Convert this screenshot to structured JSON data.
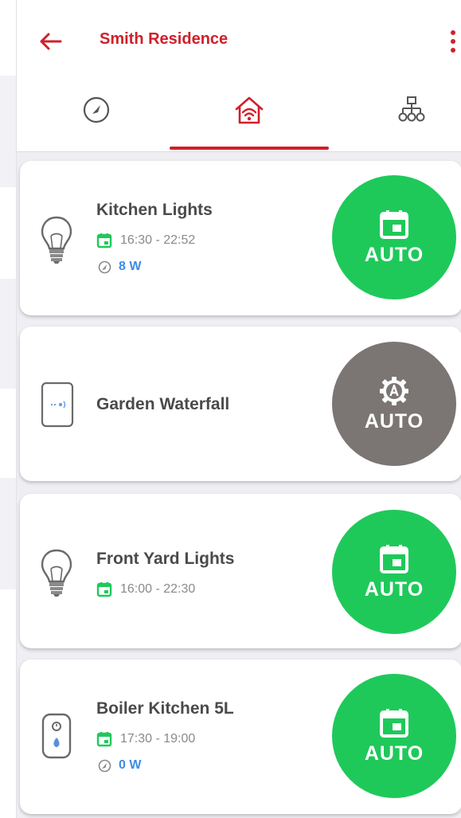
{
  "header": {
    "title": "Smith Residence"
  },
  "tabs": [
    {
      "icon": "gauge-icon"
    },
    {
      "icon": "smart-home-icon",
      "active": true
    },
    {
      "icon": "network-tree-icon"
    }
  ],
  "colors": {
    "brand": "#d0202a",
    "auto_active": "#1ec95a",
    "auto_manual": "#7b7573",
    "schedule": "#1ec95a",
    "power": "#3c8de8"
  },
  "devices": [
    {
      "name": "Kitchen Lights",
      "icon": "lightbulb-icon",
      "schedule": "16:30 - 22:52",
      "power": "8 W",
      "mode_label": "AUTO",
      "mode_icon": "calendar-icon"
    },
    {
      "name": "Garden  Waterfall",
      "icon": "wall-switch-icon",
      "mode_label": "AUTO",
      "mode_icon": "gear-auto-icon"
    },
    {
      "name": "Front Yard Lights",
      "icon": "lightbulb-icon",
      "schedule": "16:00 - 22:30",
      "mode_label": "AUTO",
      "mode_icon": "calendar-icon"
    },
    {
      "name": "Boiler Kitchen 5L",
      "icon": "water-boiler-icon",
      "schedule": "17:30 - 19:00",
      "power": "0 W",
      "mode_label": "AUTO",
      "mode_icon": "calendar-icon"
    }
  ]
}
